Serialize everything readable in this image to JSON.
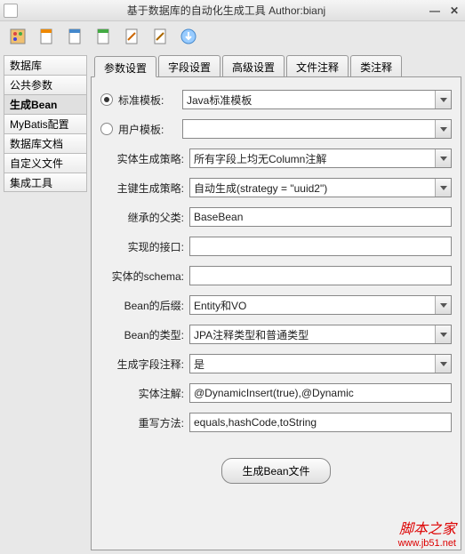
{
  "window": {
    "title": "基于数据库的自动化生成工具 Author:bianj"
  },
  "sidebar": {
    "items": [
      {
        "label": "数据库"
      },
      {
        "label": "公共参数"
      },
      {
        "label": "生成Bean"
      },
      {
        "label": "MyBatis配置"
      },
      {
        "label": "数据库文档"
      },
      {
        "label": "自定义文件"
      },
      {
        "label": "集成工具"
      }
    ]
  },
  "tabs": [
    {
      "label": "参数设置"
    },
    {
      "label": "字段设置"
    },
    {
      "label": "高级设置"
    },
    {
      "label": "文件注释"
    },
    {
      "label": "类注释"
    }
  ],
  "form": {
    "stdTemplateLabel": "标准模板:",
    "stdTemplateValue": "Java标准模板",
    "userTemplateLabel": "用户模板:",
    "userTemplateValue": "",
    "entityStrategyLabel": "实体生成策略:",
    "entityStrategyValue": "所有字段上均无Column注解",
    "pkStrategyLabel": "主键生成策略:",
    "pkStrategyValue": "自动生成(strategy = \"uuid2\")",
    "parentClassLabel": "继承的父类:",
    "parentClassValue": "BaseBean",
    "interfaceLabel": "实现的接口:",
    "interfaceValue": "",
    "schemaLabel": "实体的schema:",
    "schemaValue": "",
    "suffixLabel": "Bean的后缀:",
    "suffixValue": "Entity和VO",
    "beanTypeLabel": "Bean的类型:",
    "beanTypeValue": "JPA注释类型和普通类型",
    "fieldCommentLabel": "生成字段注释:",
    "fieldCommentValue": "是",
    "entityAnnoLabel": "实体注解:",
    "entityAnnoValue": "@DynamicInsert(true),@Dynamic",
    "overrideLabel": "重写方法:",
    "overrideValue": "equals,hashCode,toString"
  },
  "generateBtn": "生成Bean文件",
  "watermark": {
    "line1": "脚本之家",
    "line2": "www.jb51.net"
  }
}
